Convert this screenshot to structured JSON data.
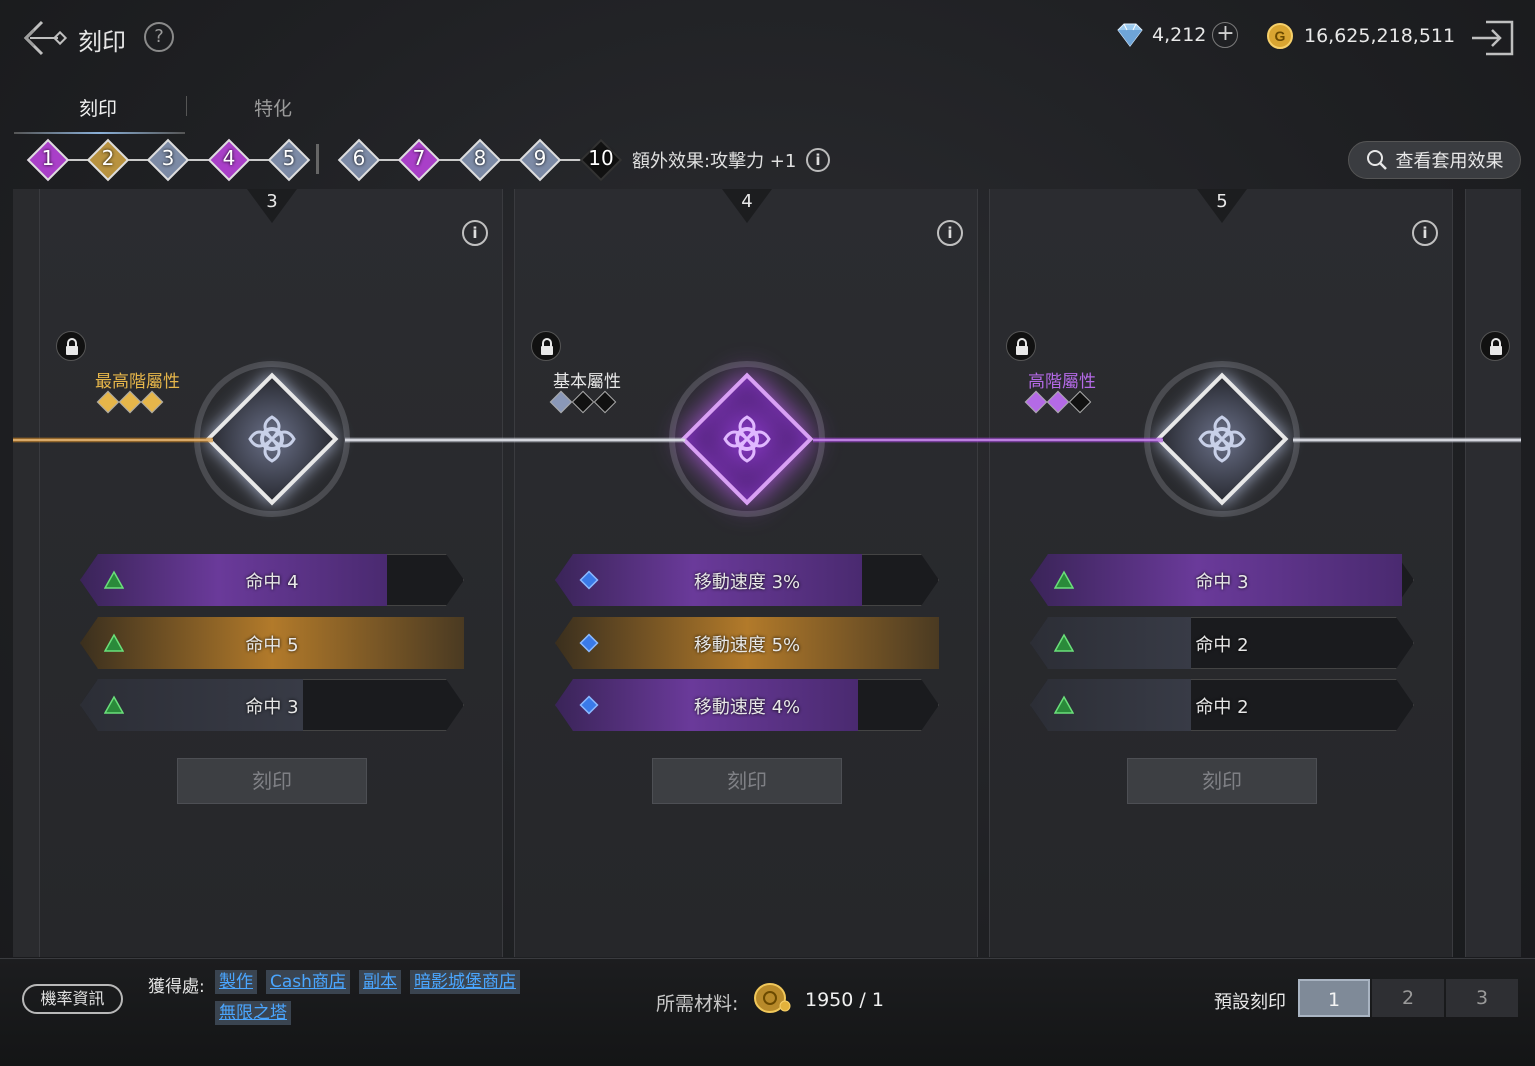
{
  "header": {
    "title": "刻印",
    "help_icon": "question-icon",
    "diamonds": "4,212",
    "gold": "16,625,218,511",
    "colors": {
      "diamond": "#7fb6e8",
      "gold": "#e3b23c"
    }
  },
  "tabs": [
    {
      "label": "刻印",
      "active": true
    },
    {
      "label": "特化",
      "active": false
    }
  ],
  "levels": {
    "items": [
      {
        "num": "1",
        "color": "#a93fc8"
      },
      {
        "num": "2",
        "color": "#b8923f"
      },
      {
        "num": "3",
        "color": "#7c8aa5"
      },
      {
        "num": "4",
        "color": "#a93fc8"
      },
      {
        "num": "5",
        "color": "#7c8aa5"
      },
      {
        "num": "6",
        "color": "#7c8aa5"
      },
      {
        "num": "7",
        "color": "#a93fc8"
      },
      {
        "num": "8",
        "color": "#7c8aa5"
      },
      {
        "num": "9",
        "color": "#7c8aa5"
      },
      {
        "num": "10",
        "color": "#111111"
      }
    ],
    "bonus": "額外效果:攻擊力 +1",
    "set_button": "查看套用效果"
  },
  "cards": [
    {
      "number": "3",
      "grade": "最高階屬性",
      "grade_color": "#e6b64a",
      "line_color": "#d08a2a",
      "emblem_color": "#c8ccd6",
      "stats": [
        {
          "text": "命中 4",
          "fill": 0.8,
          "type": "purple"
        },
        {
          "text": "命中 5",
          "fill": 1.0,
          "type": "gold"
        },
        {
          "text": "命中 3",
          "fill": 0.58,
          "type": "gray"
        }
      ],
      "engrave": "刻印"
    },
    {
      "number": "4",
      "grade": "基本屬性",
      "grade_color": "#e8e8e8",
      "line_color": "#c9ccd6",
      "emblem_color": "#b05ae0",
      "stats": [
        {
          "text": "移動速度 3%",
          "fill": 0.8,
          "type": "purple"
        },
        {
          "text": "移動速度 5%",
          "fill": 1.0,
          "type": "gold"
        },
        {
          "text": "移動速度 4%",
          "fill": 0.79,
          "type": "purple"
        }
      ],
      "engrave": "刻印"
    },
    {
      "number": "5",
      "grade": "高階屬性",
      "grade_color": "#b46ae6",
      "line_color": "#a44ad8",
      "emblem_color": "#c8ccd6",
      "stats": [
        {
          "text": "命中 3",
          "fill": 0.97,
          "type": "purple"
        },
        {
          "text": "命中 2",
          "fill": 0.42,
          "type": "gray"
        },
        {
          "text": "命中 2",
          "fill": 0.42,
          "type": "gray"
        }
      ],
      "engrave": "刻印"
    }
  ],
  "footer": {
    "probability_button": "機率資訊",
    "obtain_label": "獲得處:",
    "sources": [
      "製作",
      "Cash商店",
      "副本",
      "暗影城堡商店",
      "無限之塔"
    ],
    "material_label": "所需材料:",
    "material_count": "1950 / 1",
    "preset_label": "預設刻印",
    "presets": [
      "1",
      "2",
      "3"
    ],
    "active_preset": "1"
  }
}
